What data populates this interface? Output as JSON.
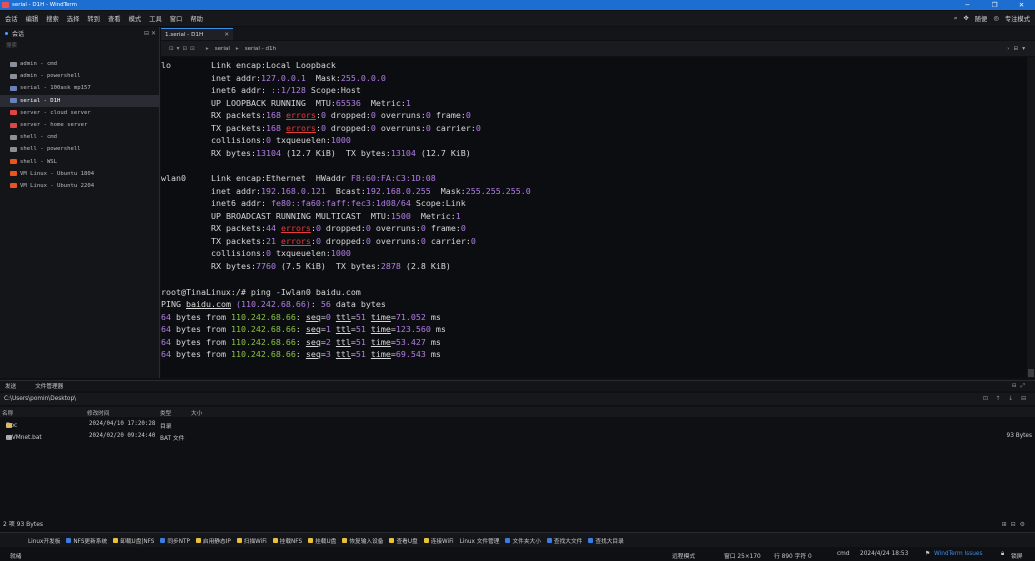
{
  "window": {
    "title": "serial - D1H - WindTerm",
    "controls": [
      "─",
      "❐",
      "✕"
    ]
  },
  "menu": {
    "items": [
      "会话",
      "编辑",
      "搜索",
      "选择",
      "转到",
      "查看",
      "模式",
      "工具",
      "窗口",
      "帮助"
    ],
    "right": [
      "随便",
      "专注模式"
    ]
  },
  "sidebar": {
    "title": "会话",
    "search_placeholder": "搜索",
    "items": [
      {
        "label": "admin - cmd",
        "icon": "terminal-icon"
      },
      {
        "label": "admin - powershell",
        "icon": "terminal-icon"
      },
      {
        "label": "serial - 100ask mp157",
        "icon": "serial-icon"
      },
      {
        "label": "serial - D1H",
        "icon": "serial-icon"
      },
      {
        "label": "server - cloud server",
        "icon": "server-icon"
      },
      {
        "label": "server - home server",
        "icon": "server-icon"
      },
      {
        "label": "shell - cmd",
        "icon": "terminal-icon"
      },
      {
        "label": "shell - powershell",
        "icon": "terminal-icon"
      },
      {
        "label": "shell - WSL",
        "icon": "ubuntu-icon"
      },
      {
        "label": "VM Linux - Ubuntu 1804",
        "icon": "ubuntu-icon"
      },
      {
        "label": "VM Linux - Ubuntu 2204",
        "icon": "ubuntu-icon"
      }
    ]
  },
  "tab": {
    "label": "1.serial - D1H"
  },
  "breadcrumb": [
    "serial",
    "serial - d1h"
  ],
  "terminal": {
    "lo": {
      "iface": "lo",
      "l1": "Link encap:Local Loopback",
      "inet_addr": "127.0.0.1",
      "mask": "255.0.0.0",
      "inet6": "::1/128",
      "scope": "Host",
      "mtu": "65536",
      "metric": "1",
      "rx_packets": "168",
      "rx_errors": "0",
      "rx_dropped": "0",
      "rx_overruns": "0",
      "rx_frame": "0",
      "tx_packets": "168",
      "tx_errors": "0",
      "tx_dropped": "0",
      "tx_overruns": "0",
      "tx_carrier": "0",
      "collisions": "0",
      "txqueuelen": "1000",
      "rx_bytes": "13104",
      "rx_bytes_h": "(12.7 KiB)",
      "tx_bytes": "13104",
      "tx_bytes_h": "(12.7 KiB)",
      "flags": "UP LOOPBACK RUNNING"
    },
    "wlan0": {
      "iface": "wlan0",
      "hwaddr": "F8:60:FA:C3:1D:08",
      "inet_addr": "192.168.0.121",
      "bcast": "192.168.0.255",
      "mask": "255.255.255.0",
      "inet6": "fe80::fa60:faff:fec3:1d08/64",
      "scope": "Link",
      "flags": "UP BROADCAST RUNNING MULTICAST",
      "mtu": "1500",
      "metric": "1",
      "rx_packets": "44",
      "rx_errors": "0",
      "rx_dropped": "0",
      "rx_overruns": "0",
      "rx_frame": "0",
      "tx_packets": "21",
      "tx_errors": "0",
      "tx_dropped": "0",
      "tx_overruns": "0",
      "tx_carrier": "0",
      "collisions": "0",
      "txqueuelen": "1000",
      "rx_bytes": "7760",
      "rx_bytes_h": "(7.5 KiB)",
      "tx_bytes": "2878",
      "tx_bytes_h": "(2.8 KiB)"
    },
    "prompt": "root@TinaLinux:/# ping -Iwlan0 baidu.com",
    "ping_head": {
      "host": "baidu.com",
      "ip": "(110.242.68.66)",
      "bytes": "56"
    },
    "ping_ip": "110.242.68.66",
    "ping_rows": [
      {
        "seq": "0",
        "ttl": "51",
        "time": "71.052"
      },
      {
        "seq": "1",
        "ttl": "51",
        "time": "123.560"
      },
      {
        "seq": "2",
        "ttl": "51",
        "time": "53.427"
      },
      {
        "seq": "3",
        "ttl": "51",
        "time": "69.543"
      }
    ]
  },
  "bottom_panel": {
    "tabs": [
      "发送",
      "文件管理器"
    ],
    "path": "C:\\Users\\pomin\\Desktop\\",
    "columns": [
      "名称",
      "修改时间",
      "类型",
      "大小"
    ],
    "rows": [
      {
        "name": "Doc",
        "date": "2024/04/10 17:20:28",
        "type": "目录",
        "size": "",
        "icon": "folder-icon"
      },
      {
        "name": "reVMnet.bat",
        "date": "2024/02/20 09:24:40",
        "type": "BAT 文件",
        "size": "93 Bytes",
        "icon": "file-icon"
      }
    ],
    "status": "2 项 93 Bytes"
  },
  "quickbar": [
    {
      "label": "Linux开发板",
      "icon": ""
    },
    {
      "label": "NFS更新系统",
      "icon": "blue"
    },
    {
      "label": "卸载U盘|NFS",
      "icon": "yellow"
    },
    {
      "label": "同步NTP",
      "icon": "blue"
    },
    {
      "label": "启用静态IP",
      "icon": "yellow"
    },
    {
      "label": "扫描WiFi",
      "icon": "yellow"
    },
    {
      "label": "挂载NFS",
      "icon": "yellow"
    },
    {
      "label": "挂载U盘",
      "icon": "yellow"
    },
    {
      "label": "恢复输入设备",
      "icon": "yellow"
    },
    {
      "label": "查看U盘",
      "icon": "yellow"
    },
    {
      "label": "连接WiFi",
      "icon": "yellow"
    },
    {
      "label": "Linux 文件管理",
      "icon": ""
    },
    {
      "label": "文件夹大小",
      "icon": "blue"
    },
    {
      "label": "查找大文件",
      "icon": "blue"
    },
    {
      "label": "查找大目录",
      "icon": "blue"
    }
  ],
  "statusbar": {
    "ready": "就绪",
    "mode": "远程模式",
    "window": "窗口 25×170",
    "pos": "行 890 字符 0",
    "shell": "cmd",
    "datetime": "2024/4/24 18:53",
    "issues": "WindTerm Issues",
    "lock": "锁屏"
  }
}
